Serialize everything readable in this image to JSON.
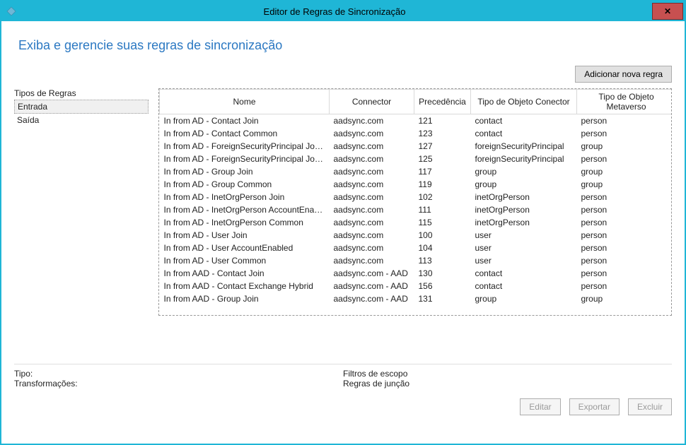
{
  "window": {
    "title": "Editor de Regras de Sincronização"
  },
  "page": {
    "heading": "Exiba e gerencie suas regras de sincronização",
    "add_button": "Adicionar nova regra"
  },
  "sidebar": {
    "title": "Tipos de Regras",
    "items": [
      {
        "label": "Entrada",
        "selected": true
      },
      {
        "label": "Saída",
        "selected": false
      }
    ]
  },
  "grid": {
    "columns": {
      "nome": "Nome",
      "connector": "Connector",
      "precedencia": "Precedência",
      "tipo_conector": "Tipo de Objeto Conector",
      "tipo_metaverso": "Tipo de Objeto Metaverso"
    },
    "rows": [
      {
        "nome": "In from AD - Contact Join",
        "connector": "aadsync.com",
        "precedencia": "121",
        "tipo_conector": "contact",
        "tipo_metaverso": "person"
      },
      {
        "nome": "In from AD - Contact Common",
        "connector": "aadsync.com",
        "precedencia": "123",
        "tipo_conector": "contact",
        "tipo_metaverso": "person"
      },
      {
        "nome": "In from AD - ForeignSecurityPrincipal Join Group",
        "connector": "aadsync.com",
        "precedencia": "127",
        "tipo_conector": "foreignSecurityPrincipal",
        "tipo_metaverso": "group"
      },
      {
        "nome": "In from AD - ForeignSecurityPrincipal Join User",
        "connector": "aadsync.com",
        "precedencia": "125",
        "tipo_conector": "foreignSecurityPrincipal",
        "tipo_metaverso": "person"
      },
      {
        "nome": "In from AD - Group Join",
        "connector": "aadsync.com",
        "precedencia": "117",
        "tipo_conector": "group",
        "tipo_metaverso": "group"
      },
      {
        "nome": "In from AD - Group Common",
        "connector": "aadsync.com",
        "precedencia": "119",
        "tipo_conector": "group",
        "tipo_metaverso": "group"
      },
      {
        "nome": "In from AD - InetOrgPerson Join",
        "connector": "aadsync.com",
        "precedencia": "102",
        "tipo_conector": "inetOrgPerson",
        "tipo_metaverso": "person"
      },
      {
        "nome": "In from AD - InetOrgPerson AccountEnabled",
        "connector": "aadsync.com",
        "precedencia": "111",
        "tipo_conector": "inetOrgPerson",
        "tipo_metaverso": "person"
      },
      {
        "nome": "In from AD - InetOrgPerson Common",
        "connector": "aadsync.com",
        "precedencia": "115",
        "tipo_conector": "inetOrgPerson",
        "tipo_metaverso": "person"
      },
      {
        "nome": "In from AD - User Join",
        "connector": "aadsync.com",
        "precedencia": "100",
        "tipo_conector": "user",
        "tipo_metaverso": "person"
      },
      {
        "nome": "In from AD - User AccountEnabled",
        "connector": "aadsync.com",
        "precedencia": "104",
        "tipo_conector": "user",
        "tipo_metaverso": "person"
      },
      {
        "nome": "In from AD - User Common",
        "connector": "aadsync.com",
        "precedencia": "113",
        "tipo_conector": "user",
        "tipo_metaverso": "person"
      },
      {
        "nome": "In from AAD - Contact Join",
        "connector": "aadsync.com - AAD",
        "precedencia": "130",
        "tipo_conector": "contact",
        "tipo_metaverso": "person"
      },
      {
        "nome": "In from AAD - Contact Exchange Hybrid",
        "connector": "aadsync.com - AAD",
        "precedencia": "156",
        "tipo_conector": "contact",
        "tipo_metaverso": "person"
      },
      {
        "nome": "In from AAD - Group Join",
        "connector": "aadsync.com - AAD",
        "precedencia": "131",
        "tipo_conector": "group",
        "tipo_metaverso": "group"
      }
    ]
  },
  "bottom": {
    "tipo_label": "Tipo:",
    "trans_label": "Transformações:",
    "filtros_label": "Filtros de escopo",
    "juncao_label": "Regras de junção",
    "editar": "Editar",
    "exportar": "Exportar",
    "excluir": "Excluir"
  }
}
